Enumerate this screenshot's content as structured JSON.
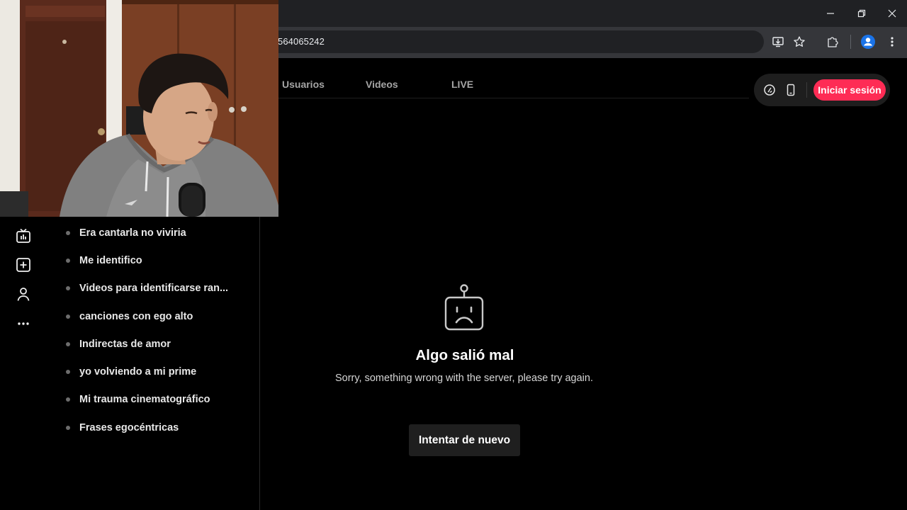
{
  "browser": {
    "url_visible": "564065242",
    "window_controls": [
      {
        "name": "minimize-icon",
        "glyph": "—"
      },
      {
        "name": "restore-icon",
        "glyph": "❐"
      },
      {
        "name": "close-icon",
        "glyph": "✕"
      }
    ],
    "toolbar_icons": [
      "install-app-icon",
      "bookmark-star-icon",
      "extensions-puzzle-icon",
      "profile-avatar-icon",
      "more-vert-icon"
    ]
  },
  "header": {
    "tabs": [
      {
        "label": "Usuarios"
      },
      {
        "label": "Videos"
      },
      {
        "label": "LIVE"
      }
    ],
    "icons": [
      "coin-icon",
      "phone-icon"
    ],
    "login_label": "Iniciar sesión",
    "accent": "#fe2c55"
  },
  "sidebar": {
    "icons": [
      "live-tv-icon",
      "upload-plus-icon",
      "profile-person-icon",
      "more-dots-icon"
    ],
    "suggestions": [
      "Era cantarla no viviria",
      "Me identifico",
      "Videos para identificarse ran...",
      "canciones con ego alto",
      "Indirectas de amor",
      "yo volviendo a mi prime",
      "Mi trauma cinematográfico",
      "Frases egocéntricas"
    ]
  },
  "error": {
    "icon": "sad-robot-icon",
    "title": "Algo salió mal",
    "message": "Sorry, something wrong with the server, please try again.",
    "retry_label": "Intentar de nuevo"
  },
  "overlay": {
    "type": "webcam",
    "subject": "person-in-grey-hoodie"
  }
}
